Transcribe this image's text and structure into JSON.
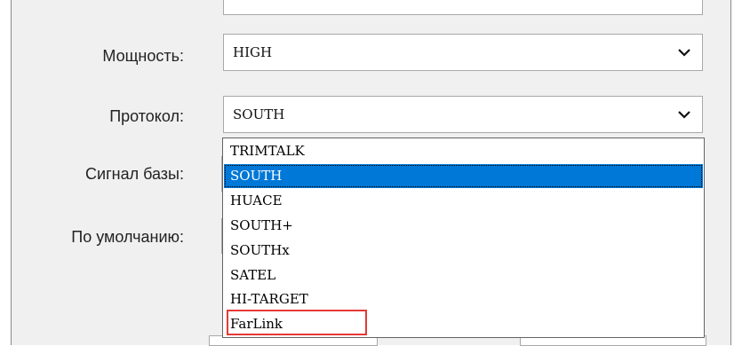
{
  "form": {
    "power": {
      "label": "Мощность:",
      "value": "HIGH"
    },
    "protocol": {
      "label": "Протокол:",
      "value": "SOUTH",
      "options": [
        "TRIMTALK",
        "SOUTH",
        "HUACE",
        "SOUTH+",
        "SOUTHx",
        "SATEL",
        "HI-TARGET",
        "FarLink"
      ],
      "selected_index": 1
    },
    "base_signal": {
      "label": "Сигнал базы:"
    },
    "default": {
      "label": "По умолчанию:"
    }
  },
  "colors": {
    "selection": "#0078d7",
    "annotation": "#e53935"
  },
  "icons": {
    "dropdown": "chevron-down-icon"
  }
}
